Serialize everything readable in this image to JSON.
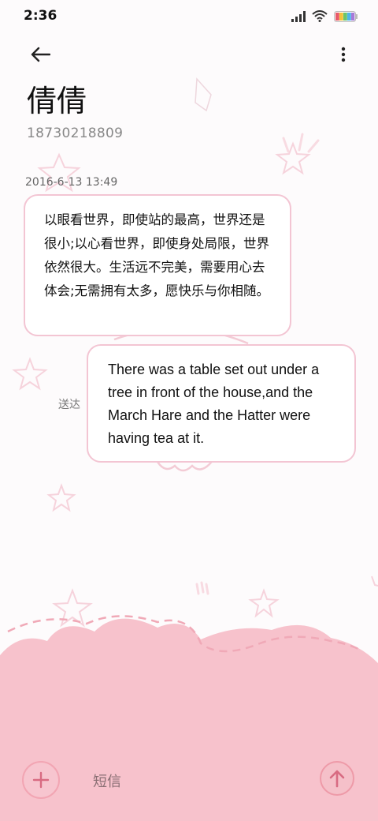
{
  "status_bar": {
    "time": "2:36",
    "icons": [
      "signal-icon",
      "wifi-icon",
      "battery-icon"
    ]
  },
  "header": {
    "back_icon": "arrow-left-icon",
    "menu_icon": "more-vertical-icon"
  },
  "contact": {
    "name": "倩倩",
    "phone": "18730218809"
  },
  "conversation": {
    "timestamp": "2016-6-13 13:49",
    "messages": [
      {
        "direction": "incoming",
        "text": "以眼看世界，即使站的最高，世界还是很小;以心看世界，即使身处局限，世界依然很大。生活远不完美，需要用心去体会;无需拥有太多，愿快乐与你相随。"
      },
      {
        "direction": "outgoing",
        "text": "There was a table set out under a tree in front of the house,and the March Hare and the Hatter were having tea at it.",
        "status": "送达"
      }
    ]
  },
  "compose": {
    "placeholder": "短信",
    "add_icon": "plus-icon",
    "send_icon": "arrow-up-icon"
  },
  "colors": {
    "accent_pink": "#f6bfca",
    "bubble_border": "#f3c5d3",
    "background": "#fdfbfc"
  }
}
